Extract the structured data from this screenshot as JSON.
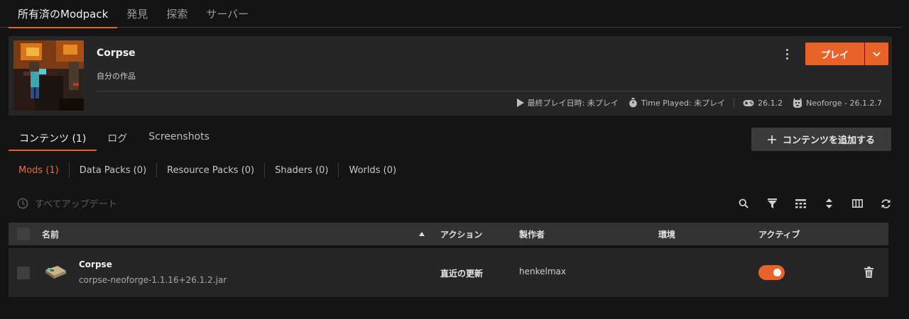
{
  "top_tabs": {
    "owned": "所有済のModpack",
    "discover": "発見",
    "explore": "探索",
    "servers": "サーバー"
  },
  "pack": {
    "name": "Corpse",
    "description": "自分の作品",
    "last_played": "最終プレイ日時: 未プレイ",
    "time_played": "Time Played: 未プレイ",
    "game_version": "26.1.2",
    "loader": "Neoforge - 26.1.2.7",
    "play_label": "プレイ"
  },
  "content_tabs": {
    "contents": "コンテンツ (1)",
    "log": "ログ",
    "screenshots": "Screenshots"
  },
  "add_content_label": "コンテンツを追加する",
  "subtabs": {
    "mods": "Mods (1)",
    "data_packs": "Data Packs (0)",
    "resource_packs": "Resource Packs (0)",
    "shaders": "Shaders (0)",
    "worlds": "Worlds (0)"
  },
  "update_all_label": "すべてアップデート",
  "table": {
    "headers": {
      "name": "名前",
      "action": "アクション",
      "author": "製作者",
      "environment": "環境",
      "active": "アクティブ"
    },
    "rows": [
      {
        "name": "Corpse",
        "file": "corpse-neoforge-1.1.16+26.1.2.jar",
        "action": "直近の更新",
        "author": "henkelmax",
        "environment": "",
        "active": true
      }
    ]
  },
  "colors": {
    "accent": "#e8622a",
    "background": "#141414",
    "card": "#262626",
    "table_header": "#333333"
  }
}
